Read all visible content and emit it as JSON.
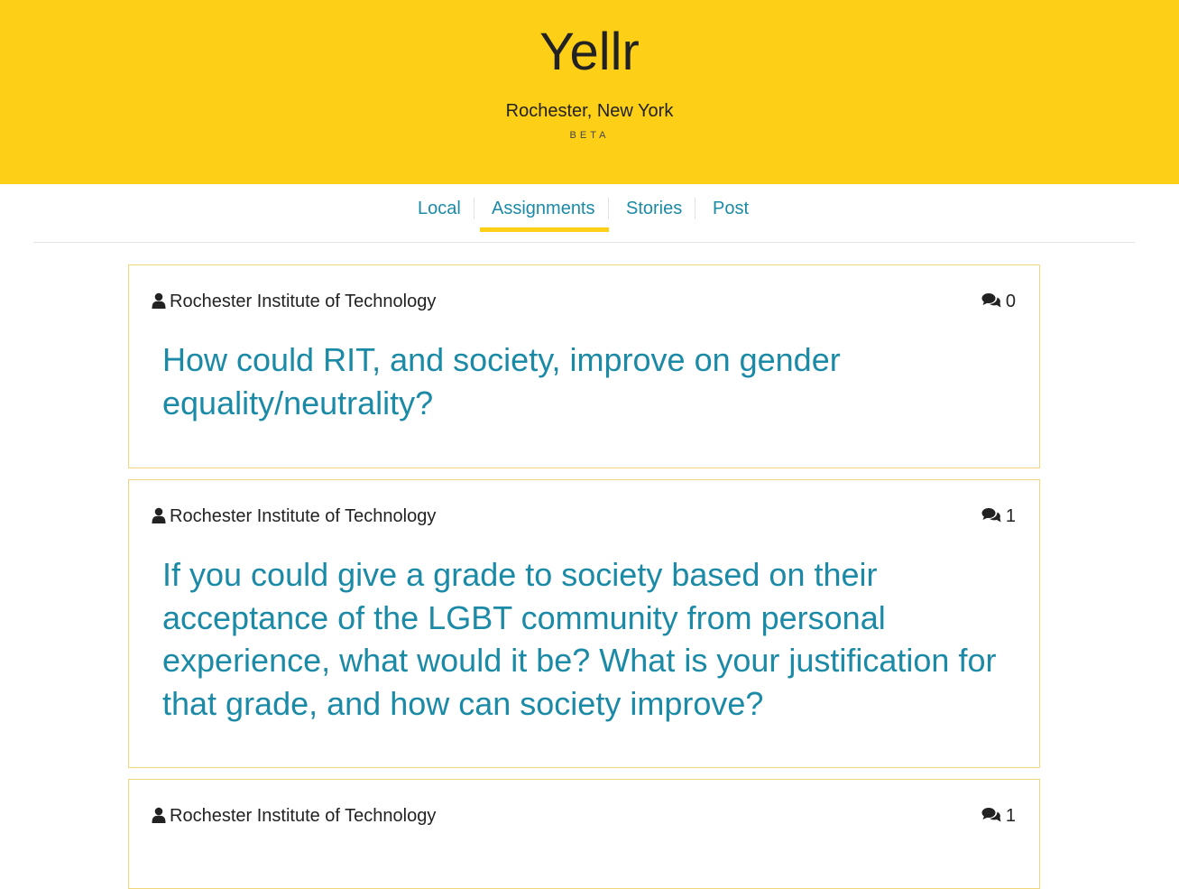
{
  "header": {
    "title": "Yellr",
    "location": "Rochester, New York",
    "badge": "BETA"
  },
  "nav": {
    "tabs": [
      {
        "label": "Local",
        "active": false
      },
      {
        "label": "Assignments",
        "active": true
      },
      {
        "label": "Stories",
        "active": false
      },
      {
        "label": "Post",
        "active": false
      }
    ]
  },
  "assignments": [
    {
      "organization": "Rochester Institute of Technology",
      "comment_count": "0",
      "question": "How could RIT, and society, improve on gender equality/neutrality?"
    },
    {
      "organization": "Rochester Institute of Technology",
      "comment_count": "1",
      "question": "If you could give a grade to society based on their acceptance of the LGBT community from personal experience, what would it be? What is your justification for that grade, and how can society improve?"
    },
    {
      "organization": "Rochester Institute of Technology",
      "comment_count": "1",
      "question": ""
    }
  ],
  "colors": {
    "brand_yellow": "#fdd017",
    "link_teal": "#1b8aa6",
    "card_border": "#f0d67a"
  },
  "icons": {
    "user": "user-icon",
    "comments": "comments-icon"
  }
}
